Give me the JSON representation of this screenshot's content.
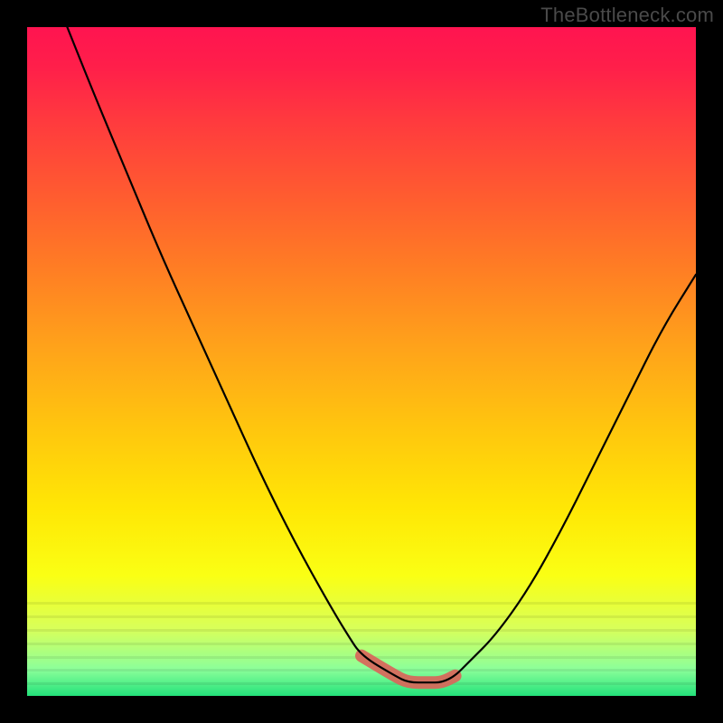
{
  "watermark": "TheBottleneck.com",
  "colors": {
    "frame_background": "#000000",
    "watermark_text": "#4a4a4a",
    "gradient_top": "#ff1450",
    "gradient_mid": "#ffe705",
    "gradient_bottom": "#23e27a",
    "curve_stroke": "#000000",
    "valley_highlight": "#d9655a"
  },
  "chart_data": {
    "type": "line",
    "title": "",
    "xlabel": "",
    "ylabel": "",
    "xlim": [
      0,
      100
    ],
    "ylim": [
      0,
      100
    ],
    "series": [
      {
        "name": "bottleneck-curve",
        "x": [
          6,
          10,
          15,
          20,
          25,
          30,
          35,
          40,
          45,
          48,
          50,
          55,
          57,
          60,
          62,
          64,
          66,
          70,
          75,
          80,
          85,
          90,
          95,
          100
        ],
        "y": [
          100,
          90,
          78,
          66,
          55,
          44,
          33,
          23,
          14,
          9,
          6,
          3,
          2,
          2,
          2,
          3,
          5,
          9,
          16,
          25,
          35,
          45,
          55,
          63
        ]
      }
    ],
    "annotations": [
      {
        "name": "valley-highlight",
        "x_range": [
          50,
          64
        ],
        "y_approx": 2,
        "color": "#d9655a"
      }
    ],
    "background_bands_y": [
      86,
      88,
      90,
      92,
      94,
      96,
      98
    ]
  }
}
